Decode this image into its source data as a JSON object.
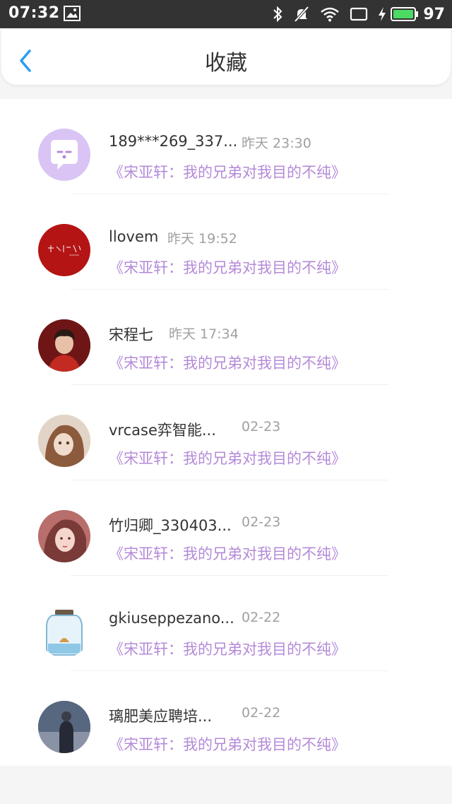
{
  "status_bar": {
    "time": "07:32",
    "battery": "97"
  },
  "header": {
    "title": "收藏"
  },
  "items": [
    {
      "name": "189***269_337...",
      "time": "昨天 23:30",
      "subtitle": "《宋亚轩：我的兄弟对我目的不纯》"
    },
    {
      "name": "llovem",
      "time": "昨天 19:52",
      "subtitle": "《宋亚轩：我的兄弟对我目的不纯》"
    },
    {
      "name": "宋程七",
      "time": "昨天 17:34",
      "subtitle": "《宋亚轩：我的兄弟对我目的不纯》"
    },
    {
      "name": "vrcase弈智能...",
      "time": "02-23",
      "subtitle": "《宋亚轩：我的兄弟对我目的不纯》"
    },
    {
      "name": "竹归卿_330403...",
      "time": "02-23",
      "subtitle": "《宋亚轩：我的兄弟对我目的不纯》"
    },
    {
      "name": "gkiuseppezano...",
      "time": "02-22",
      "subtitle": "《宋亚轩：我的兄弟对我目的不纯》"
    },
    {
      "name": "璃肥美应聘培...",
      "time": "02-22",
      "subtitle": "《宋亚轩：我的兄弟对我目的不纯》"
    }
  ],
  "colors": {
    "accent_blue": "#2a9df4",
    "subtitle_purple": "#b48ad8",
    "battery_green": "#4cd964"
  }
}
